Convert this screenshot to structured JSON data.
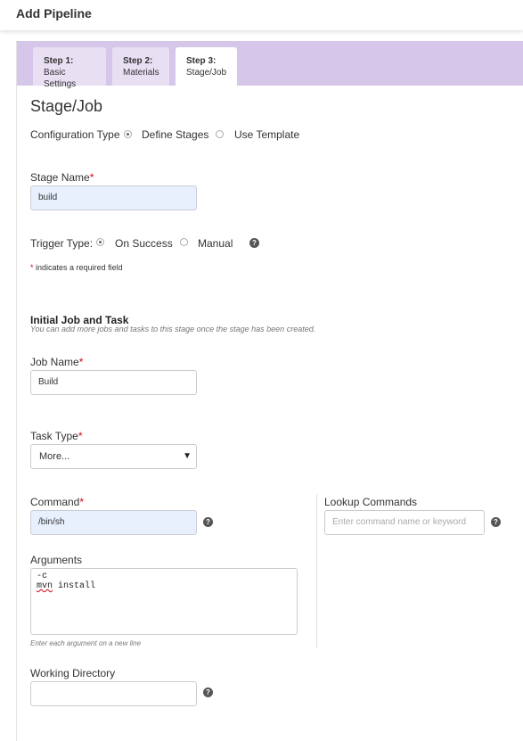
{
  "header": {
    "title": "Add Pipeline"
  },
  "tabs": [
    {
      "num": "Step 1:",
      "label": "Basic Settings"
    },
    {
      "num": "Step 2:",
      "label": "Materials"
    },
    {
      "num": "Step 3:",
      "label": "Stage/Job"
    }
  ],
  "active_tab_index": 2,
  "page_title": "Stage/Job",
  "config_type": {
    "label": "Configuration Type",
    "options": [
      "Define Stages",
      "Use Template"
    ],
    "selected": "Define Stages"
  },
  "stage_name": {
    "label": "Stage Name",
    "required_mark": "*",
    "value": "build"
  },
  "trigger_type": {
    "label": "Trigger Type:",
    "options": [
      "On Success",
      "Manual"
    ],
    "selected": "On Success",
    "help": "?"
  },
  "required_note": {
    "mark": "*",
    "text": "indicates a required field"
  },
  "initial_job": {
    "title": "Initial Job and Task",
    "subtitle": "You can add more jobs and tasks to this stage once the stage has been created."
  },
  "job_name": {
    "label": "Job Name",
    "required_mark": "*",
    "value": "Build"
  },
  "task_type": {
    "label": "Task Type",
    "required_mark": "*",
    "selected": "More...",
    "caret": "▼"
  },
  "command": {
    "label": "Command",
    "required_mark": "*",
    "value": "/bin/sh",
    "help": "?"
  },
  "lookup": {
    "label": "Lookup Commands",
    "placeholder": "Enter command name or keyword",
    "help": "?"
  },
  "arguments": {
    "label": "Arguments",
    "line1": "-c",
    "line2_word1": "mvn",
    "line2_rest": " install",
    "hint": "Enter each argument on a new line"
  },
  "working_dir": {
    "label": "Working Directory",
    "value": "",
    "help": "?"
  }
}
